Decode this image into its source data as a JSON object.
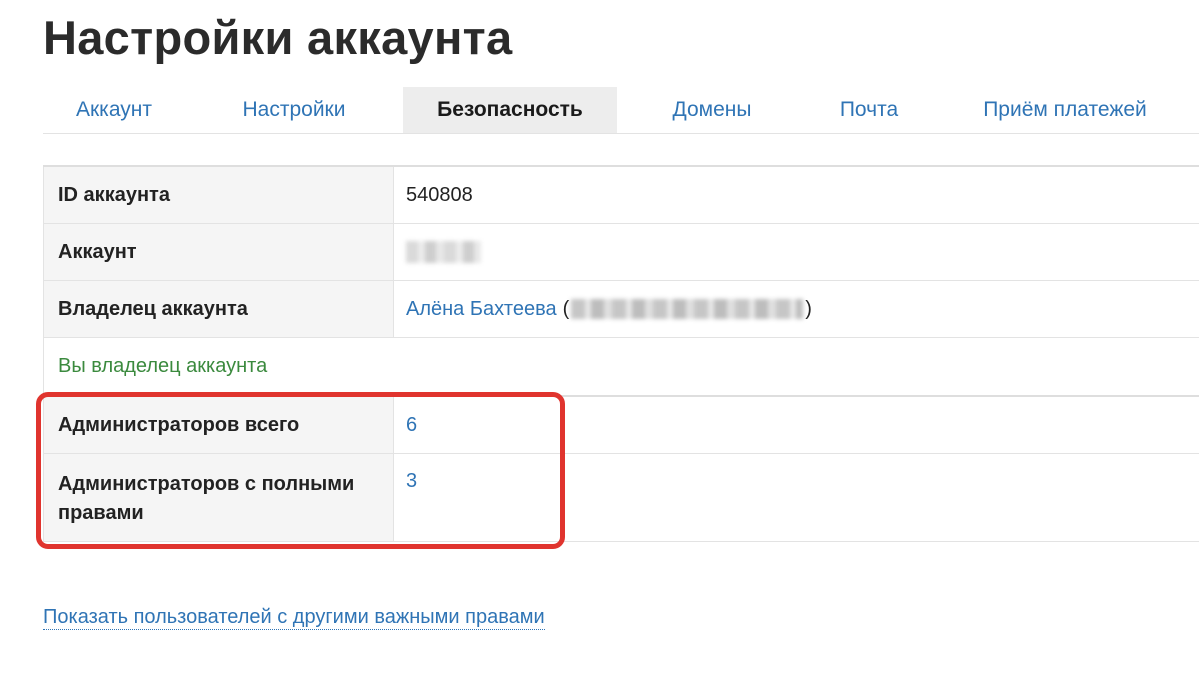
{
  "page": {
    "title": "Настройки аккаунта"
  },
  "tabs": [
    {
      "label": "Аккаунт",
      "active": false
    },
    {
      "label": "Настройки",
      "active": false
    },
    {
      "label": "Безопасность",
      "active": true
    },
    {
      "label": "Домены",
      "active": false
    },
    {
      "label": "Почта",
      "active": false
    },
    {
      "label": "Приём платежей",
      "active": false
    }
  ],
  "account_info": {
    "id_label": "ID аккаунта",
    "id_value": "540808",
    "account_label": "Аккаунт",
    "owner_label": "Владелец аккаунта",
    "owner_name": "Алёна Бахтеева",
    "owner_paren_open": "(",
    "owner_paren_close": ")",
    "owner_note": "Вы владелец аккаунта",
    "admins_total_label": "Администраторов всего",
    "admins_total_value": "6",
    "admins_full_label": "Администраторов с полными правами",
    "admins_full_value": "3"
  },
  "footer": {
    "show_users_link": "Показать пользователей с другими важными правами"
  },
  "colors": {
    "link": "#2f74b5",
    "owner_note": "#3b8a3e",
    "highlight": "#e0342e",
    "active_tab_bg": "#ededed"
  }
}
